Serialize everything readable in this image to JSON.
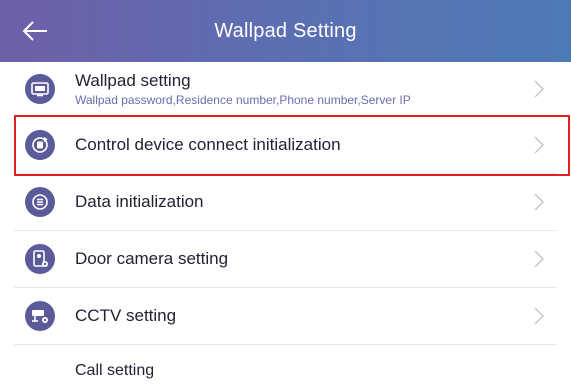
{
  "header": {
    "title": "Wallpad Setting"
  },
  "items": [
    {
      "title": "Wallpad setting",
      "subtitle": "Wallpad password,Residence number,Phone number,Server IP"
    },
    {
      "title": "Control device connect initialization"
    },
    {
      "title": "Data initialization"
    },
    {
      "title": "Door camera setting"
    },
    {
      "title": "CCTV setting"
    },
    {
      "title": "Call setting"
    }
  ],
  "colors": {
    "header_start": "#6e5fa9",
    "header_end": "#4d7ab6",
    "icon_bg": "#5b5b99",
    "highlight": "#e02020"
  }
}
